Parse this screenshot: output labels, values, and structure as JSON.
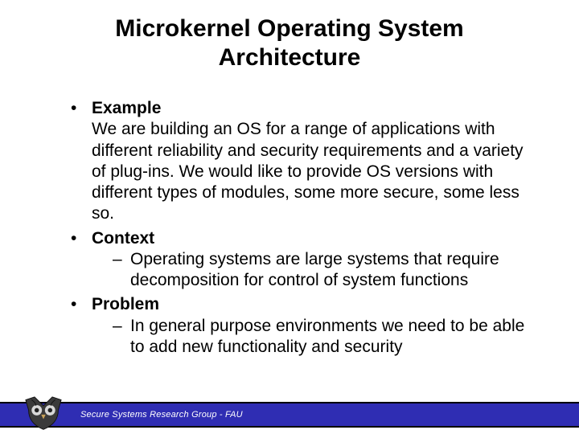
{
  "title": "Microkernel Operating System Architecture",
  "bullets": [
    {
      "head": "Example",
      "para": "We are building an OS for a range of applications with different reliability and security requirements and a variety of plug-ins. We would like to provide OS versions with different types of modules, some more secure, some less so."
    },
    {
      "head": "Context",
      "sub": [
        "Operating systems are large systems that require decomposition for control of system functions"
      ]
    },
    {
      "head": "Problem",
      "sub": [
        "In general purpose environments we need to be able to add new functionality and security"
      ]
    }
  ],
  "footer": "Secure Systems Research Group - FAU",
  "icon_name": "owl-logo"
}
